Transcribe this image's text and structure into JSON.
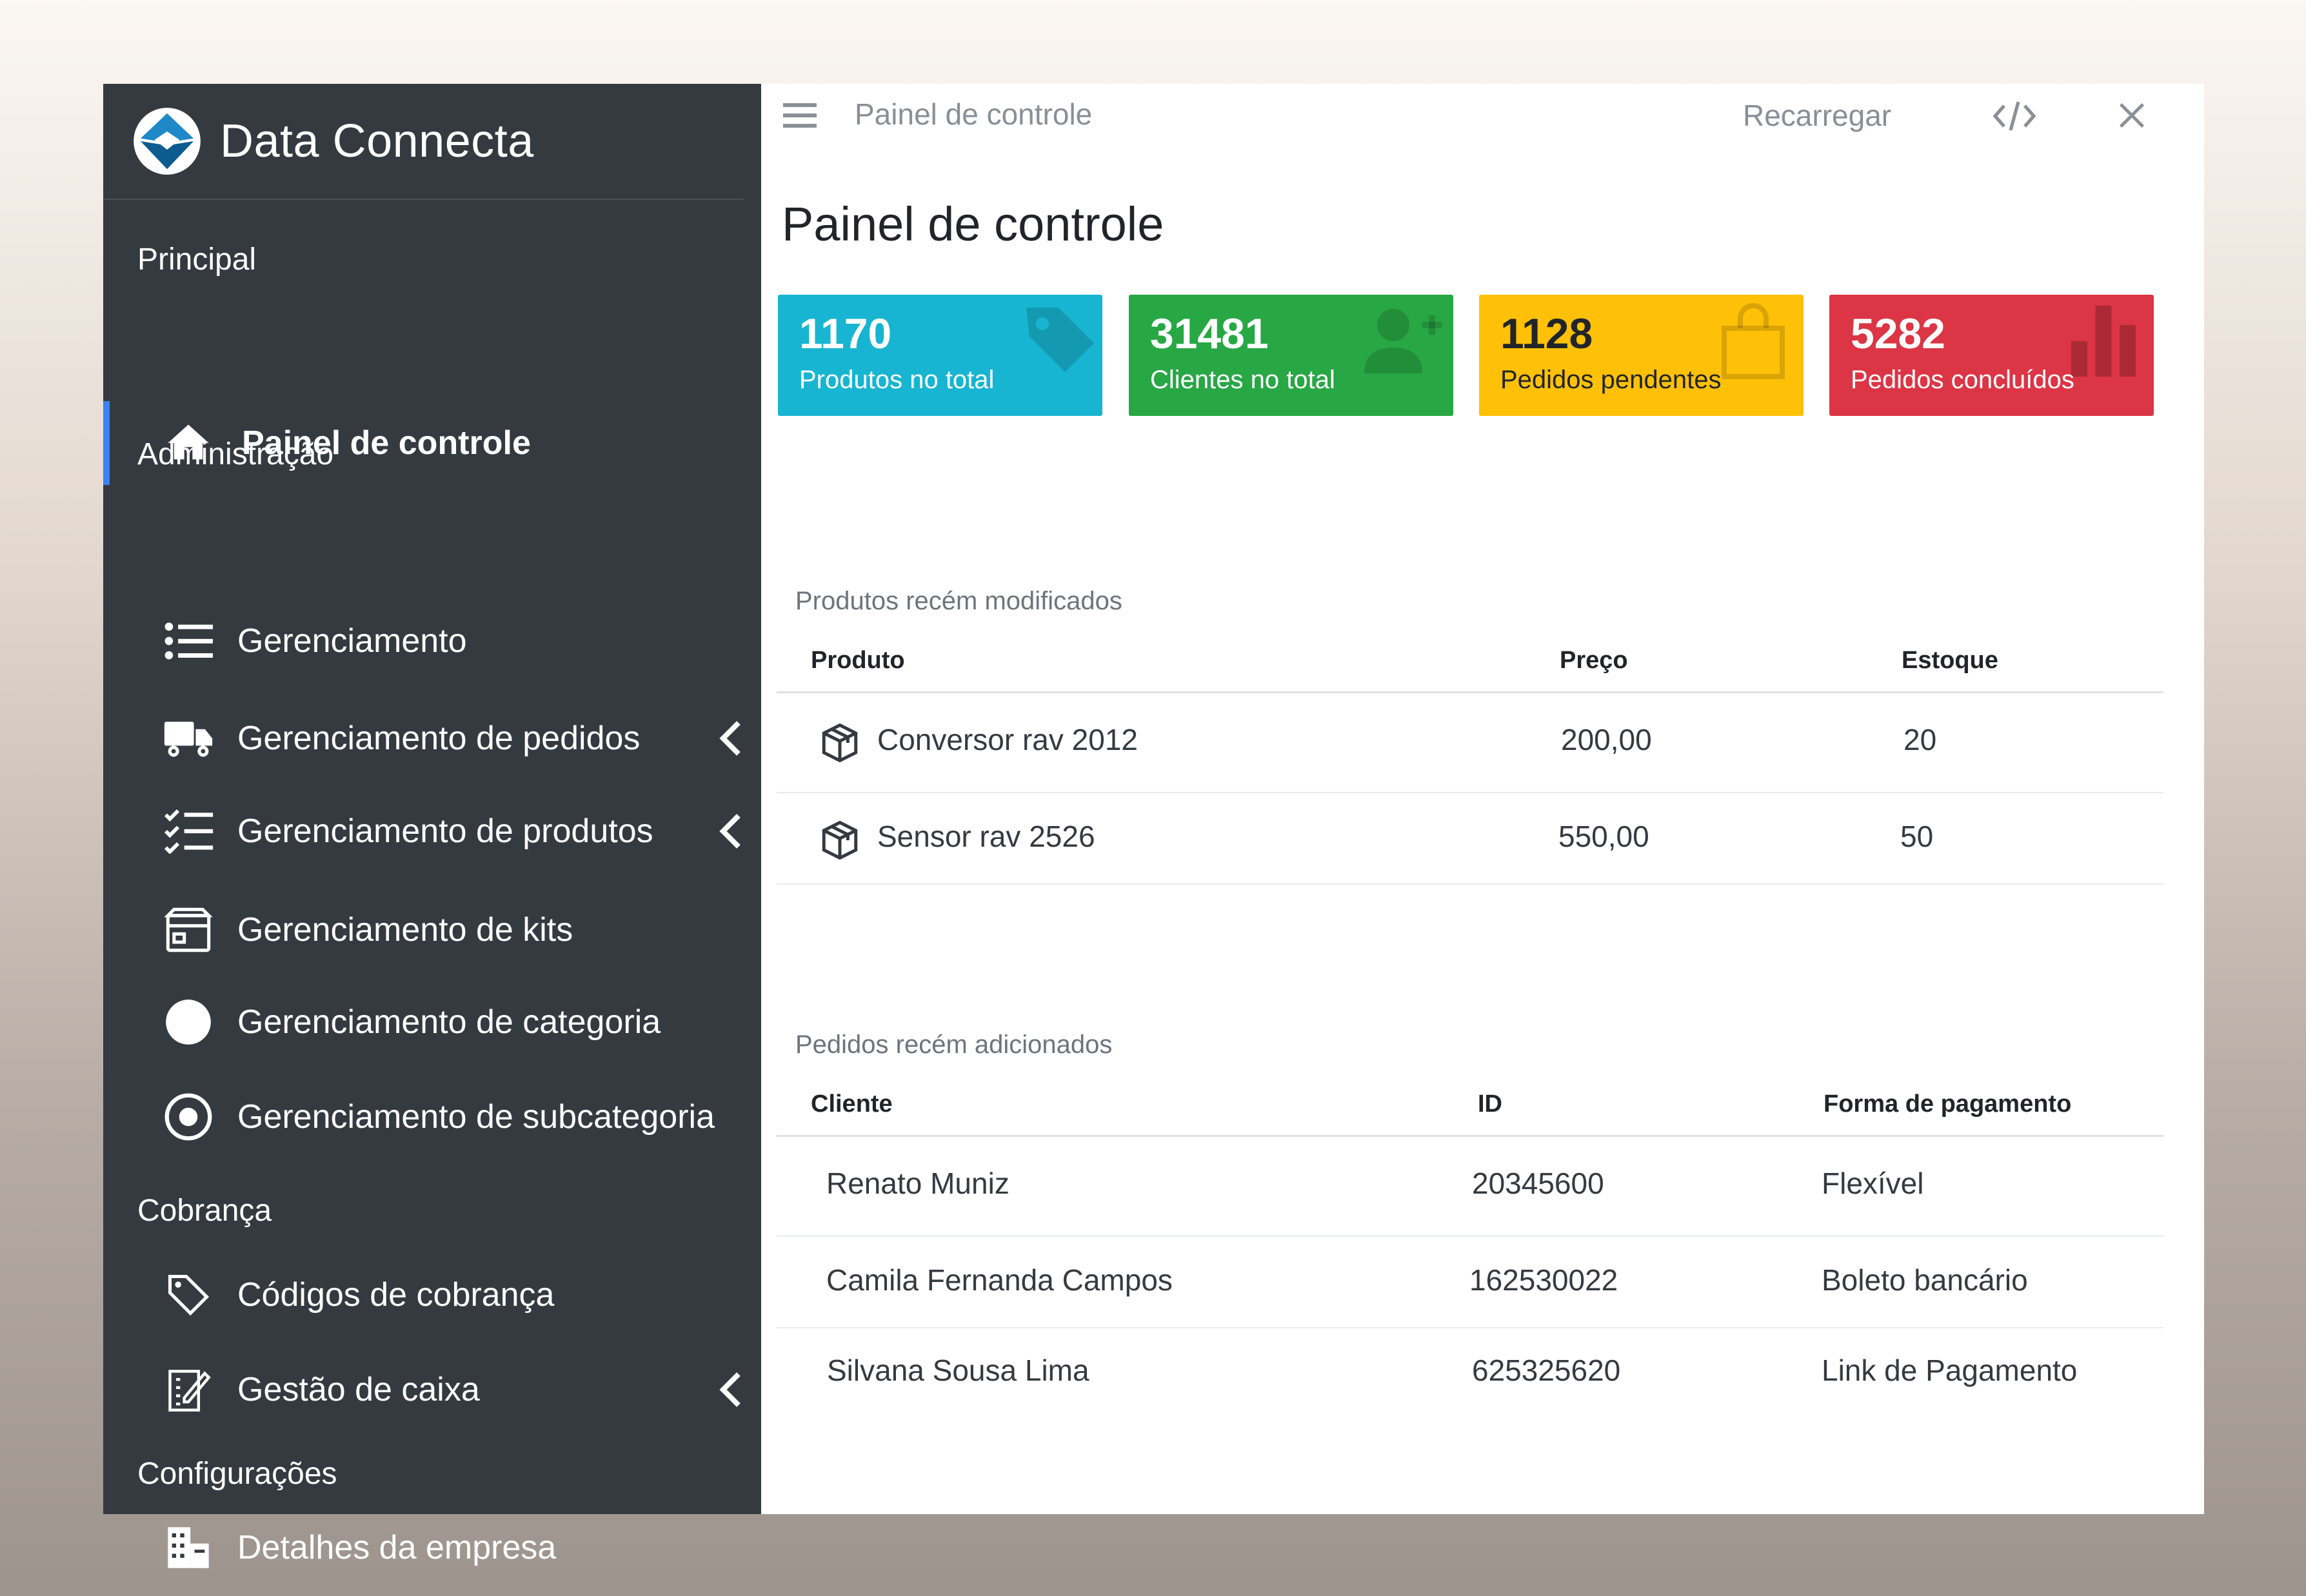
{
  "brand": {
    "name": "Data Connecta"
  },
  "sidebar": {
    "sections": {
      "principal": "Principal",
      "administracao": "Administração",
      "cobranca": "Cobrança",
      "configuracoes": "Configurações"
    },
    "items": [
      {
        "label": "Painel de controle",
        "icon": "home-icon",
        "active": true
      },
      {
        "label": "Gerenciamento",
        "icon": "list-icon"
      },
      {
        "label": "Gerenciamento de pedidos",
        "icon": "truck-icon",
        "expandable": true
      },
      {
        "label": "Gerenciamento de produtos",
        "icon": "checklist-icon",
        "expandable": true
      },
      {
        "label": "Gerenciamento de kits",
        "icon": "box-icon"
      },
      {
        "label": "Gerenciamento de categoria",
        "icon": "circle-icon"
      },
      {
        "label": "Gerenciamento de subcategoria",
        "icon": "radio-icon"
      },
      {
        "label": "Códigos de cobrança",
        "icon": "tag-icon"
      },
      {
        "label": "Gestão de caixa",
        "icon": "register-icon",
        "expandable": true
      },
      {
        "label": "Detalhes da empresa",
        "icon": "building-icon"
      }
    ]
  },
  "topbar": {
    "title": "Painel de controle",
    "reload": "Recarregar"
  },
  "page": {
    "title": "Painel de controle"
  },
  "stats": [
    {
      "value": "1170",
      "label": "Produtos no total",
      "color": "#17b5d1",
      "icon": "tag-icon"
    },
    {
      "value": "31481",
      "label": "Clientes no total",
      "color": "#28a745",
      "icon": "user-plus-icon"
    },
    {
      "value": "1128",
      "label": "Pedidos pendentes",
      "color": "#ffc107",
      "icon": "shopping-bag-icon"
    },
    {
      "value": "5282",
      "label": "Pedidos concluídos",
      "color": "#dc3545",
      "icon": "bar-chart-icon"
    }
  ],
  "products": {
    "title": "Produtos recém modificados",
    "columns": [
      "Produto",
      "Preço",
      "Estoque"
    ],
    "rows": [
      {
        "name": "Conversor rav 2012",
        "price": "200,00",
        "stock": "20"
      },
      {
        "name": "Sensor rav 2526",
        "price": "550,00",
        "stock": "50"
      }
    ]
  },
  "orders": {
    "title": "Pedidos recém adicionados",
    "columns": [
      "Cliente",
      "ID",
      "Forma de pagamento"
    ],
    "rows": [
      {
        "client": "Renato Muniz",
        "id": "20345600",
        "payment": "Flexível"
      },
      {
        "client": "Camila Fernanda Campos",
        "id": "162530022",
        "payment": "Boleto bancário"
      },
      {
        "client": "Silvana Sousa Lima",
        "id": "625325620",
        "payment": "Link de Pagamento"
      }
    ]
  }
}
